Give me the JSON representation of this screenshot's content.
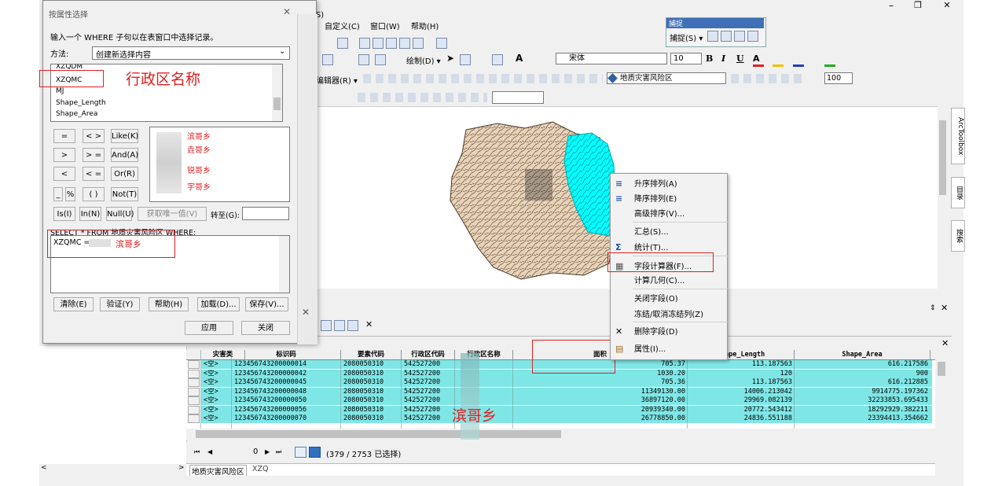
{
  "window": {
    "controls": [
      "–",
      "❐",
      "✕"
    ]
  },
  "menubar": {
    "items": [
      "自定义(C)",
      "窗口(W)",
      "帮助(H)"
    ],
    "partial_selection": "选择(S)"
  },
  "snapping": {
    "title": "捕捉",
    "label": "捕捉(S) ▾"
  },
  "draw_toolbar": {
    "draw_label": "绘制(D) ▾",
    "font": "宋体",
    "size": "10",
    "bold": "B",
    "italic": "I",
    "underline": "U",
    "text_a": "A"
  },
  "editor_toolbar": {
    "editor_label": "编辑器(R) ▾",
    "layer_select": "地质灾害风险区",
    "transparency": "100"
  },
  "dialog": {
    "title": "按属性选择",
    "instruction": "输入一个 WHERE 子句以在表窗口中选择记录。",
    "method_label": "方法:",
    "method_value": "创建新选择内容",
    "fields": [
      "XZQDM",
      "XZQMC",
      "MJ",
      "Shape_Length",
      "Shape_Area"
    ],
    "operators": {
      "eq": "=",
      "ne": "< >",
      "like": "Like(K)",
      "gt": ">",
      "ge": "> =",
      "and": "And(A)",
      "lt": "<",
      "le": "< =",
      "or": "Or(R)",
      "us": "_",
      "pct": "%",
      "paren": "( )",
      "not": "Not(T)",
      "is": "Is(I)",
      "in": "In(N)",
      "null": "Null(U)"
    },
    "unique_values": [
      "滨哥乡",
      "垚哥乡",
      "锐哥乡",
      "宇哥乡"
    ],
    "get_unique": "获取唯一值(V)",
    "goto_label": "转至(G):",
    "sql_prefix": "SELECT * FROM 地质灾害风险区 WHERE:",
    "sql_expr": "XZQMC =",
    "sql_value": "滨哥乡",
    "buttons": {
      "clear": "清除(E)",
      "verify": "验证(Y)",
      "help": "帮助(H)",
      "load": "加载(D)...",
      "save": "保存(V)...",
      "apply": "应用",
      "close": "关闭"
    }
  },
  "annotations": {
    "field_note": "行政区名称",
    "map_note": "滨哥乡"
  },
  "context_menu": {
    "items": [
      {
        "label": "升序排列(A)",
        "icon": "sort-ascending-icon"
      },
      {
        "label": "降序排列(E)",
        "icon": "sort-descending-icon"
      },
      {
        "label": "高级排序(V)...",
        "icon": ""
      },
      {
        "label": "汇总(S)...",
        "icon": ""
      },
      {
        "label": "统计(T)...",
        "icon": "sigma-icon"
      },
      {
        "label": "字段计算器(F)...",
        "icon": "calculator-icon"
      },
      {
        "label": "计算几何(C)...",
        "icon": ""
      },
      {
        "label": "关闭字段(O)",
        "icon": ""
      },
      {
        "label": "冻结/取消冻结列(Z)",
        "icon": ""
      },
      {
        "label": "删除字段(D)",
        "icon": "delete-icon"
      },
      {
        "label": "属性(I)...",
        "icon": "properties-icon"
      }
    ]
  },
  "side_tabs": [
    "ArcToolbox",
    "目录",
    "搜索"
  ],
  "table": {
    "partial_header": [
      "灾害类",
      "编码"
    ],
    "columns": [
      "灾害类",
      "标识码",
      "要素代码",
      "行政区代码",
      "行政区名称",
      "面积",
      "Shape_Length",
      "Shape_Area"
    ],
    "rows": [
      [
        "<空>",
        "123456743200000014",
        "2080050310",
        "542527200",
        "",
        "705.37",
        "113.187563",
        "616.217586"
      ],
      [
        "<空>",
        "123456743200000042",
        "2080050310",
        "542527200",
        "",
        "1030.20",
        "120",
        "900"
      ],
      [
        "<空>",
        "123456743200000045",
        "2080050310",
        "542527200",
        "",
        "705.36",
        "113.187563",
        "616.212885"
      ],
      [
        "<空>",
        "123456743200000048",
        "2080050310",
        "542527200",
        "",
        "11349130.00",
        "14006.213042",
        "9914775.197362"
      ],
      [
        "<空>",
        "123456743200000050",
        "2080050310",
        "542527200",
        "",
        "36897120.00",
        "29969.082139",
        "32233853.695433"
      ],
      [
        "<空>",
        "123456743200000056",
        "2080050310",
        "542527200",
        "",
        "20939340.00",
        "20772.543412",
        "18292929.382211"
      ],
      [
        "<空>",
        "123456743200000070",
        "2080050310",
        "542527200",
        "",
        "26778850.00",
        "24836.551188",
        "23394413.354662"
      ]
    ],
    "nav": {
      "current": "0",
      "status": "(379 / 2753 已选择)"
    },
    "tabs": [
      "地质灾害风险区",
      "XZQ"
    ]
  },
  "colors": {
    "map_fill": "#e8d2b8",
    "selection": "#00ffff",
    "annotation_red": "#e02020",
    "row_selected": "#7fe6e6"
  }
}
